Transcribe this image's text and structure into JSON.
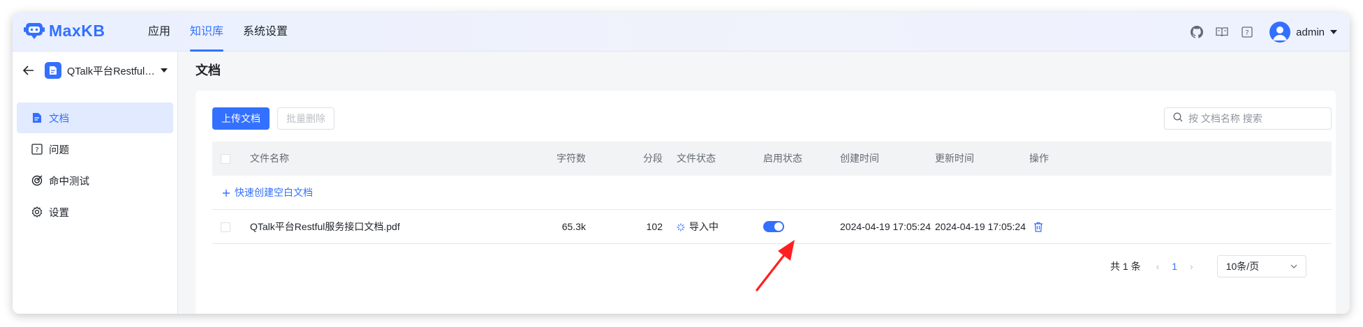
{
  "app": {
    "name": "MaxKB",
    "brand_color": "#3370ff",
    "nav": [
      {
        "label": "应用",
        "active": false
      },
      {
        "label": "知识库",
        "active": true
      },
      {
        "label": "系统设置",
        "active": false
      }
    ],
    "header_icons": [
      "github-icon",
      "book-icon",
      "help-icon"
    ],
    "user": "admin"
  },
  "sidebar": {
    "kb_name": "QTalk平台Restful服务接口文档",
    "items": [
      {
        "label": "文档",
        "icon": "document-icon",
        "active": true
      },
      {
        "label": "问题",
        "icon": "question-icon",
        "active": false
      },
      {
        "label": "命中测试",
        "icon": "target-icon",
        "active": false
      },
      {
        "label": "设置",
        "icon": "gear-icon",
        "active": false
      }
    ]
  },
  "main": {
    "title": "文档",
    "upload_label": "上传文档",
    "batch_delete_label": "批量删除",
    "search_placeholder": "按 文档名称 搜索",
    "columns": [
      "文件名称",
      "字符数",
      "分段",
      "文件状态",
      "启用状态",
      "创建时间",
      "更新时间",
      "操作"
    ],
    "quick_create_label": "快速创建空白文档",
    "rows": [
      {
        "name": "QTalk平台Restful服务接口文档.pdf",
        "chars": "65.3k",
        "segments": "102",
        "status": "导入中",
        "enabled": true,
        "created": "2024-04-19 17:05:24",
        "updated": "2024-04-19 17:05:24"
      }
    ],
    "pagination": {
      "total_label": "共 1 条",
      "current_page": "1",
      "page_size_label": "10条/页"
    }
  }
}
